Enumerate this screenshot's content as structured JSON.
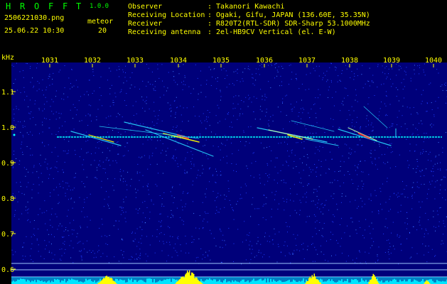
{
  "app": {
    "name_letters": [
      "H",
      "R",
      "O",
      "F",
      "F",
      "T"
    ],
    "version": "1.0.0"
  },
  "file": {
    "filename": "2506221030.png",
    "datetime": "25.06.22 10:30"
  },
  "meteor": {
    "label": "meteor",
    "count": "20"
  },
  "info": {
    "labels": [
      "Observer",
      "Receiving Location",
      "Receiver",
      "Receiving antenna"
    ],
    "values": [
      ": Takanori Kawachi",
      ": Ogaki, Gifu, JAPAN (136.60E, 35.35N)",
      ": R820T2(RTL-SDR) SDR-Sharp 53.1000MHz",
      ": 2el-HB9CV Vertical (el. E-W)"
    ]
  },
  "axes": {
    "unit": "kHz",
    "x_ticks": [
      "1031",
      "1032",
      "1033",
      "1034",
      "1035",
      "1036",
      "1037",
      "1038",
      "1039",
      "1040"
    ],
    "y_ticks": [
      "1.1",
      "1.0",
      "0.9",
      "0.8",
      "0.7",
      "0.6"
    ]
  },
  "colors": {
    "header_text": "#00ff00",
    "header_values": "#ffff00",
    "plot_bg": "#00007a",
    "noise_dot": "#1e3cff",
    "baseline": "#00ffff",
    "meteor_hot": "#ffff00",
    "activity_fill": "#ffff00",
    "bottom_band": "#00e5ff"
  }
}
